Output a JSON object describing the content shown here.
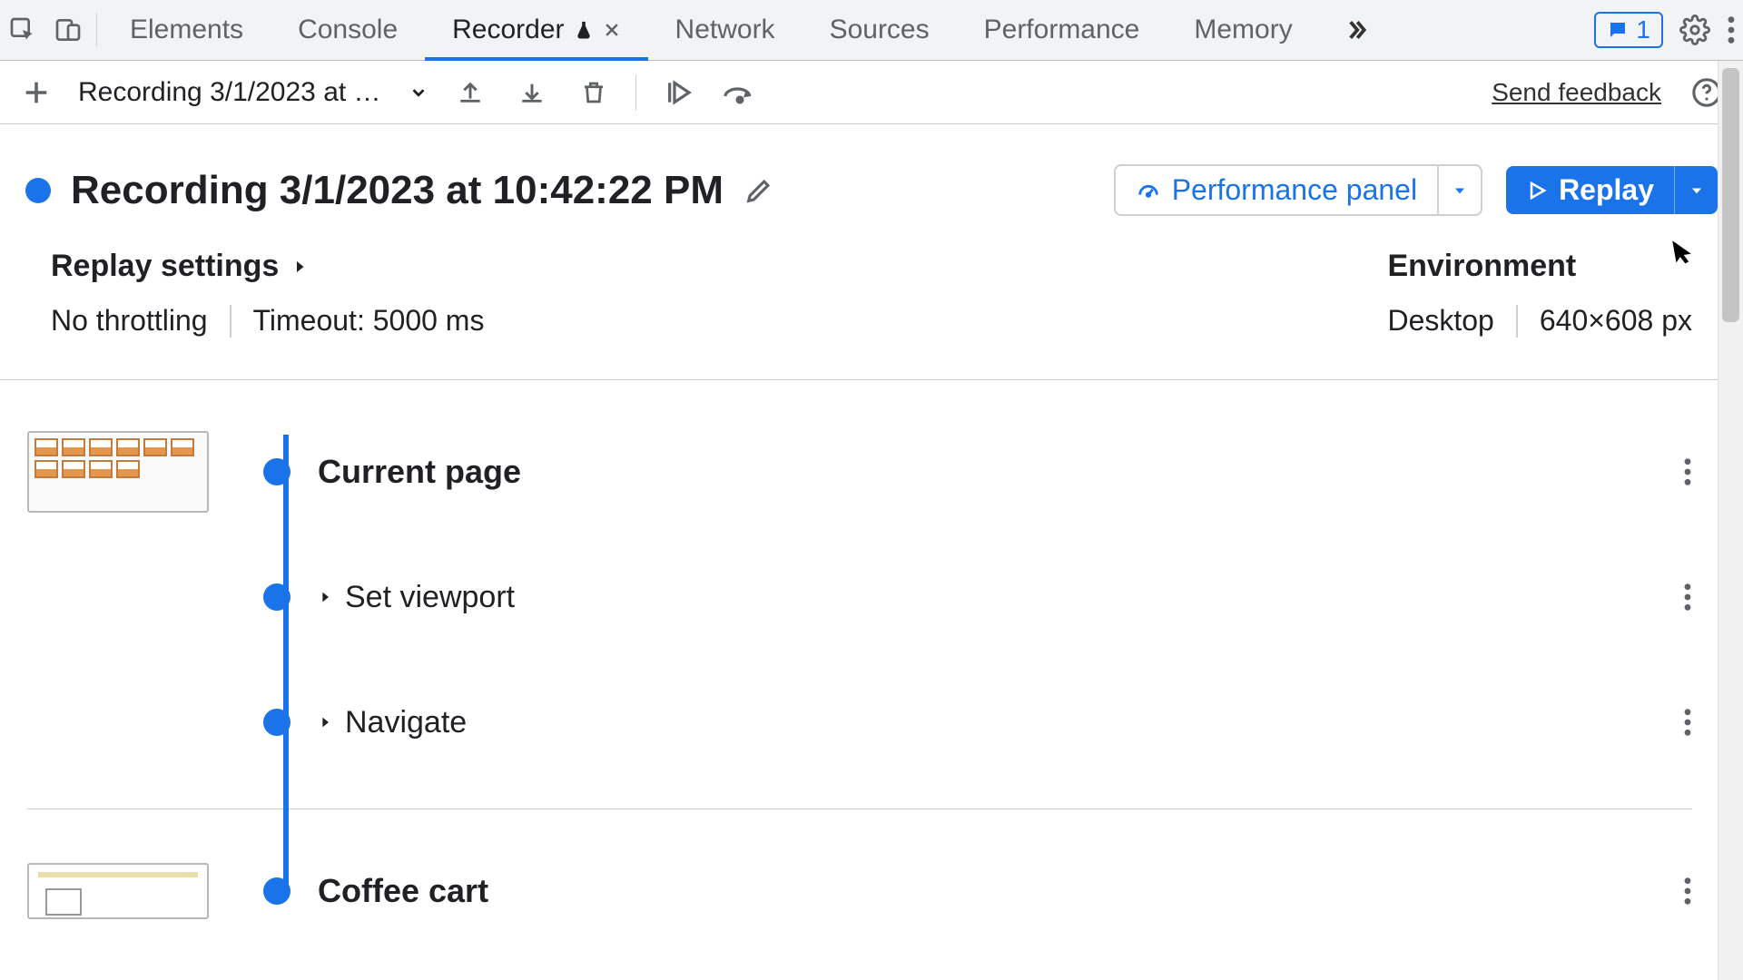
{
  "tabs": {
    "elements": "Elements",
    "console": "Console",
    "recorder": "Recorder",
    "network": "Network",
    "sources": "Sources",
    "performance": "Performance",
    "memory": "Memory"
  },
  "issues_count": "1",
  "toolbar": {
    "recording_selected": "Recording 3/1/2023 at 10…",
    "send_feedback": "Send feedback"
  },
  "recording": {
    "title": "Recording 3/1/2023 at 10:42:22 PM",
    "performance_panel": "Performance panel",
    "replay": "Replay"
  },
  "settings": {
    "replay_heading": "Replay settings",
    "throttling": "No throttling",
    "timeout": "Timeout: 5000 ms",
    "env_heading": "Environment",
    "env_device": "Desktop",
    "env_viewport": "640×608 px"
  },
  "steps": {
    "group1": {
      "s1": "Current page",
      "s2": "Set viewport",
      "s3": "Navigate"
    },
    "group2": {
      "s1": "Coffee cart"
    }
  }
}
